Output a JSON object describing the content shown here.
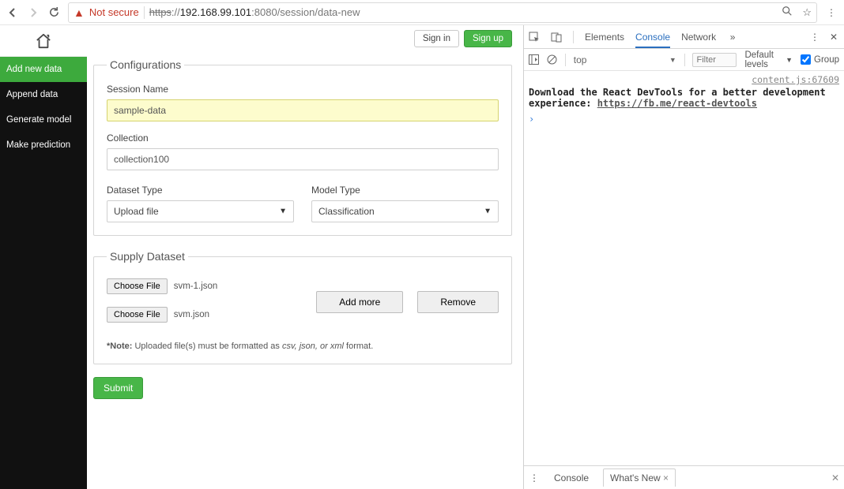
{
  "browser": {
    "not_secure": "Not secure",
    "url_scheme_strike": "https",
    "url_host": "192.168.99.101",
    "url_port": ":8080",
    "url_path": "/session/data-new"
  },
  "auth": {
    "sign_in": "Sign in",
    "sign_up": "Sign up"
  },
  "sidebar": {
    "items": [
      {
        "label": "Add new data"
      },
      {
        "label": "Append data"
      },
      {
        "label": "Generate model"
      },
      {
        "label": "Make prediction"
      }
    ]
  },
  "form": {
    "fieldset1_legend": "Configurations",
    "session_name_label": "Session Name",
    "session_name_value": "sample-data",
    "collection_label": "Collection",
    "collection_value": "collection100",
    "dataset_type_label": "Dataset Type",
    "dataset_type_value": "Upload file",
    "model_type_label": "Model Type",
    "model_type_value": "Classification",
    "fieldset2_legend": "Supply Dataset",
    "choose_file": "Choose File",
    "file1_name": "svm-1.json",
    "file2_name": "svm.json",
    "add_more": "Add more",
    "remove": "Remove",
    "note_prefix": "*Note:",
    "note_body_1": "Uploaded file(s) must be formatted as ",
    "note_formats": "csv, json, or xml",
    "note_body_2": " format.",
    "submit": "Submit"
  },
  "devtools": {
    "tabs": {
      "elements": "Elements",
      "console": "Console",
      "network": "Network"
    },
    "context": "top",
    "filter_placeholder": "Filter",
    "level": "Default levels",
    "group": "Group",
    "src_link": "content.js:67609",
    "message_1": "Download the React DevTools for a better development experience: ",
    "message_link": "https://fb.me/react-devtools",
    "bottom": {
      "console": "Console",
      "whatsnew": "What's New"
    }
  }
}
